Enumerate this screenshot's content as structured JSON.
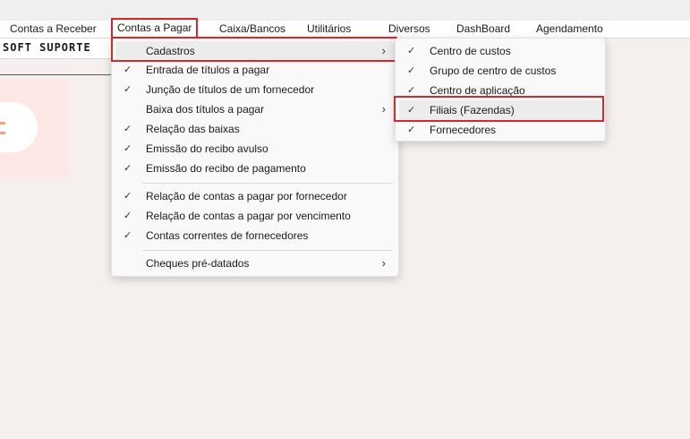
{
  "menubar": {
    "items": [
      {
        "label": "Contas a Receber"
      },
      {
        "label": "Contas a Pagar"
      },
      {
        "label": "Caixa/Bancos"
      },
      {
        "label": "Utilitários"
      },
      {
        "label": "Diversos"
      },
      {
        "label": "DashBoard"
      },
      {
        "label": "Agendamento"
      }
    ]
  },
  "userbar": {
    "label": "SOFT SUPORTE"
  },
  "accent_color": "#d9262c",
  "menu_main": {
    "items": [
      {
        "label": "Cadastros",
        "checked": false,
        "submenu": true
      },
      {
        "label": "Entrada de títulos a pagar",
        "checked": true
      },
      {
        "label": "Junção de títulos de um fornecedor",
        "checked": true
      },
      {
        "label": "Baixa dos títulos a pagar",
        "checked": false,
        "submenu": true
      },
      {
        "label": "Relação das baixas",
        "checked": true
      },
      {
        "label": "Emissão do recibo avulso",
        "checked": true
      },
      {
        "label": "Emissão do recibo de pagamento",
        "checked": true
      },
      {
        "label": "Relação de contas a pagar por fornecedor",
        "checked": true
      },
      {
        "label": "Relação de contas a pagar por vencimento",
        "checked": true
      },
      {
        "label": "Contas correntes de fornecedores",
        "checked": true
      },
      {
        "label": "Cheques pré-datados",
        "checked": false,
        "submenu": true
      }
    ]
  },
  "menu_sub": {
    "items": [
      {
        "label": "Centro de custos",
        "checked": true
      },
      {
        "label": "Grupo de centro de custos",
        "checked": true
      },
      {
        "label": "Centro de aplicação",
        "checked": true
      },
      {
        "label": "Filiais (Fazendas)",
        "checked": true
      },
      {
        "label": "Fornecedores",
        "checked": true
      }
    ]
  },
  "icons": {
    "check": "✓",
    "arrow": "›"
  }
}
